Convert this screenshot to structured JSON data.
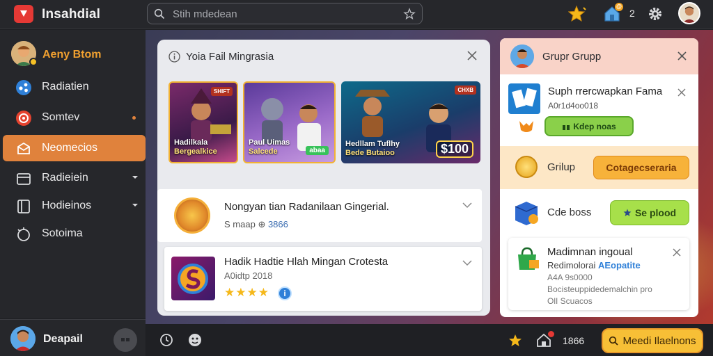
{
  "app": {
    "title": "Insahdial"
  },
  "search": {
    "placeholder": "Stih mdedean"
  },
  "topbar": {
    "count": "2",
    "notif_badge": "@"
  },
  "sidebar": {
    "user_name": "Aeny Btom",
    "items": [
      {
        "label": "Radiatien",
        "icon": "share-icon"
      },
      {
        "label": "Somtev",
        "icon": "target-icon"
      },
      {
        "label": "Neomecios",
        "icon": "briefcase-icon"
      },
      {
        "label": "Radieiein",
        "icon": "box-icon"
      },
      {
        "label": "Hodieinos",
        "icon": "bookmark-icon"
      },
      {
        "label": "Sotoima",
        "icon": "settings-icon"
      }
    ],
    "footer_name": "Deapail"
  },
  "main_panel": {
    "title": "Yoia Fail Mingrasia",
    "cards": [
      {
        "caption1": "Hadilkala",
        "caption2": "Bergealkice",
        "chip": "SHIFT"
      },
      {
        "caption1": "Paul Uimas",
        "caption2": "Salcede",
        "tag": "abaa"
      },
      {
        "caption1": "Hedllam Tuflhy",
        "caption2": "Bede Butaioo",
        "price": "$100",
        "chip": "CHXB"
      }
    ],
    "row1": {
      "title": "Nongyan tian Radanilaan Gingerial.",
      "sub_prefix": "S maap",
      "sub_value": "3866"
    },
    "row2": {
      "title": "Hadik Hadtie Hlah Mingan Crotesta",
      "sub": "A0idtp 2018",
      "stars": "★★★★",
      "info": "i"
    }
  },
  "right_panel": {
    "title": "Grupr Grupp",
    "s1": {
      "title": "Suph rrercwapkan Fama",
      "sub": "A0r1d4oo018",
      "pill": "Kdep noas"
    },
    "s2": {
      "label": "Grilup",
      "button": "Cotagecseraria"
    },
    "s3": {
      "label": "Cde boss",
      "button": "Se plood"
    },
    "s4": {
      "title": "Madimnan ingoual",
      "l1_prefix": "Redimolorai",
      "l1_highlight": "AEopatite",
      "l2": "A4A 9s0000",
      "l3": "Bocisteuppidedemalchin pro",
      "l4": "OlI Scuacos"
    }
  },
  "bottombar": {
    "count": "1866",
    "button": "Meedi Ilaelnons"
  },
  "colors": {
    "accent_orange": "#e0823c",
    "brand_red": "#e53935",
    "green_pill": "#8ad04a",
    "yellow_button": "#f7bf36"
  }
}
